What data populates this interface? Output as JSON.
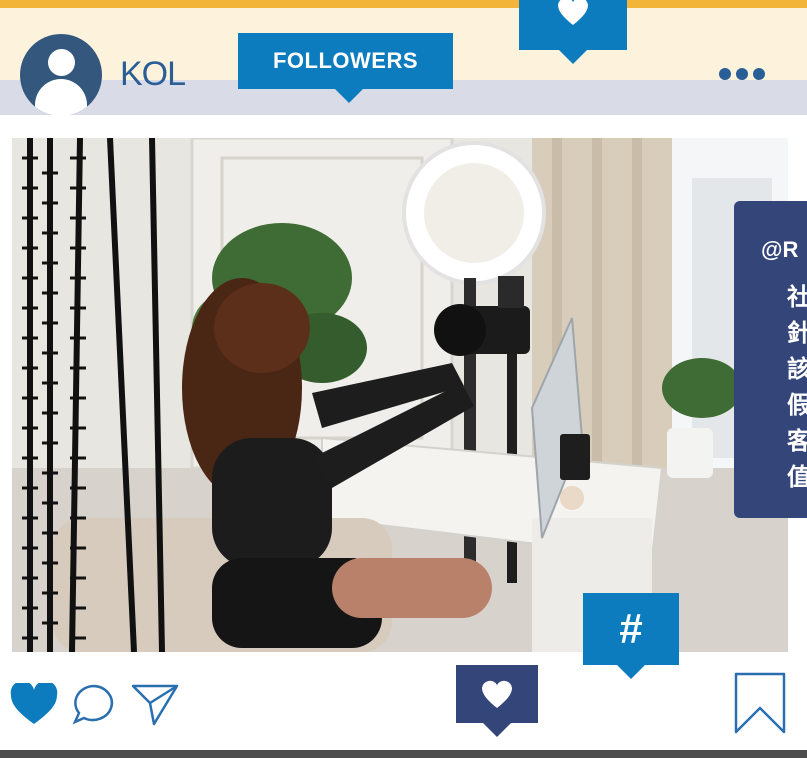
{
  "header": {
    "username": "KOL",
    "followers_label": "FOLLOWERS"
  },
  "post": {
    "hashtag": "#",
    "side_card": {
      "handle": "@R",
      "chars": [
        "社",
        "針",
        "該",
        "假",
        "客",
        "值"
      ]
    }
  },
  "icons": {
    "avatar": "user-avatar-icon",
    "top_like": "heart-icon",
    "more": "more-dots-icon",
    "like": "heart-icon",
    "comment": "comment-icon",
    "share": "paper-plane-icon",
    "center_like": "heart-icon",
    "save": "bookmark-icon"
  },
  "colors": {
    "accent_blue": "#0d7cbf",
    "navy": "#34457a",
    "avatar_blue": "#34577d",
    "background_cream": "#fdf3dc",
    "top_border": "#f2b53a"
  }
}
